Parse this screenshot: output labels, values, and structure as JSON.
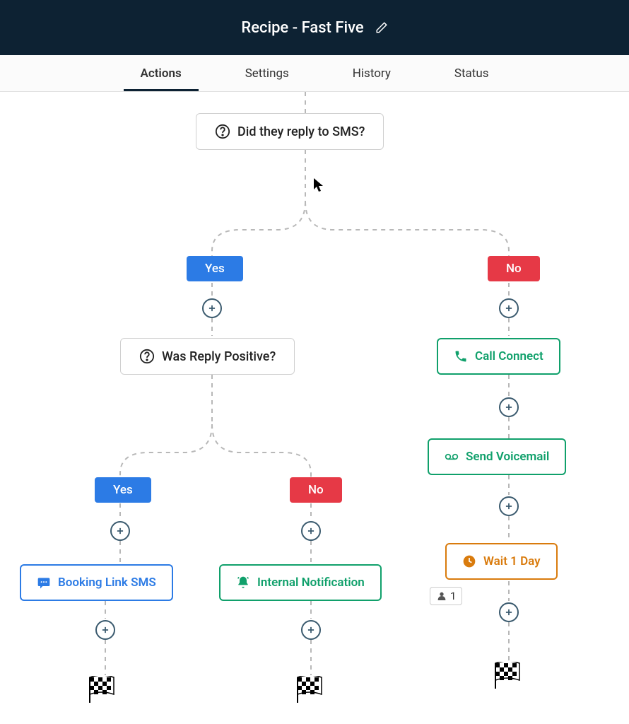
{
  "header": {
    "title": "Recipe - Fast Five"
  },
  "tabs": {
    "items": [
      {
        "label": "Actions",
        "active": true
      },
      {
        "label": "Settings",
        "active": false
      },
      {
        "label": "History",
        "active": false
      },
      {
        "label": "Status",
        "active": false
      }
    ]
  },
  "flow": {
    "decision1": "Did they reply to SMS?",
    "branch_yes": "Yes",
    "branch_no": "No",
    "decision2": "Was Reply Positive?",
    "action_call_connect": "Call Connect",
    "action_send_voicemail": "Send Voicemail",
    "action_wait": "Wait 1 Day",
    "action_booking": "Booking Link SMS",
    "action_internal": "Internal Notification",
    "person_count": "1"
  },
  "icons": {
    "question": "question-circle",
    "phone": "phone",
    "voicemail": "voicemail",
    "clock": "clock",
    "sms": "message",
    "bell": "bell",
    "finish": "checkered-flag",
    "edit": "pencil",
    "person": "person"
  },
  "colors": {
    "header_bg": "#0d2233",
    "yes": "#2c7be5",
    "no": "#e63946",
    "green": "#10a06b",
    "orange": "#d97b0d"
  }
}
